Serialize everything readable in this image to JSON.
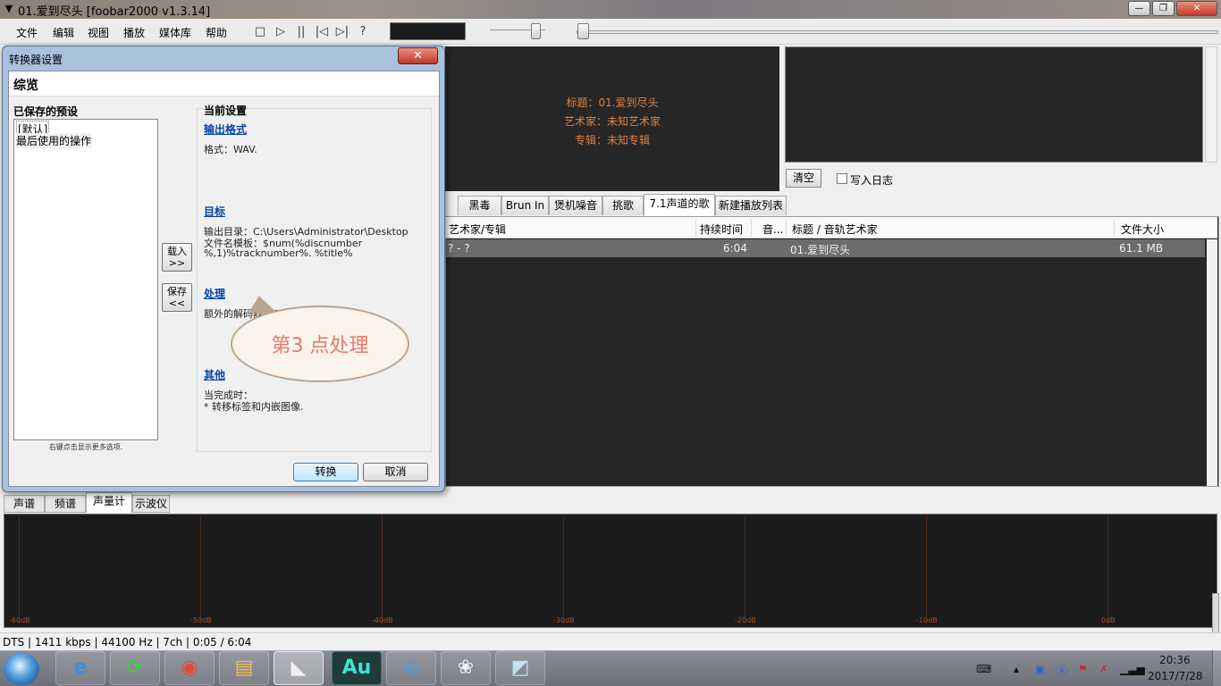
{
  "window": {
    "title": "01.爱到尽头  [foobar2000 v1.3.14]",
    "controls": [
      "—",
      "❐",
      "✕"
    ]
  },
  "menu": [
    "文件",
    "编辑",
    "视图",
    "播放",
    "媒体库",
    "帮助"
  ],
  "toolbar": [
    "□",
    "▷",
    "||",
    "|◁",
    "▷|",
    "?"
  ],
  "now_playing": {
    "title": "标题：01.爱到尽头",
    "artist": "艺术家：未知艺术家",
    "album": "专辑：未知专辑"
  },
  "console": {
    "clear_label": "清空",
    "log_label": "写入日志"
  },
  "playlist_tabs": [
    "黑毒",
    "Brun In",
    "煲机噪音",
    "挑歌",
    "7.1声道的歌",
    "新建播放列表"
  ],
  "playlist": {
    "columns": [
      "艺术家/专辑",
      "持续时间",
      "音...",
      "标题 / 音轨艺术家",
      "文件大小"
    ],
    "rows": [
      {
        "artist_album": "? - ?",
        "duration": "6:04",
        "track": "",
        "title": "01.爱到尽头",
        "size": "61.1 MB"
      }
    ]
  },
  "vis_tabs": [
    "声谱",
    "频谱",
    "声量计",
    "示波仪"
  ],
  "vis_scale": [
    "-60dB",
    "-50dB",
    "-40dB",
    "-30dB",
    "-20dB",
    "-10dB",
    "0dB"
  ],
  "status": "DTS | 1411 kbps | 44100 Hz | 7ch | 0:05 / 6:04",
  "taskbar": {
    "apps": [
      "e",
      "⟳",
      "◉",
      "▤",
      "◣",
      "Au",
      "◎",
      "❀",
      "◩"
    ],
    "time": "20:36",
    "date": "2017/7/28"
  },
  "dialog": {
    "title": "转换器设置",
    "close": "✕",
    "heading": "综览",
    "saved_presets_label": "已保存的预设",
    "presets": [
      "[默认]",
      "最后使用的操作"
    ],
    "hint": "右键点击显示更多选项.",
    "load_btn": "载入\n>>",
    "save_btn": "保存\n<<",
    "current_label": "当前设置",
    "output_format_link": "输出格式",
    "output_format_text": "格式：WAV.",
    "target_link": "目标",
    "target_text_1": "输出目录：C:\\Users\\Administrator\\Desktop",
    "target_text_2": "文件名模板：$num(%discnumber",
    "target_text_3": "%,1)%tracknumber%. %title%",
    "processing_link": "处理",
    "processing_text": "额外的解码器：Channel Mixer.",
    "other_link": "其他",
    "other_text_1": "当完成时：",
    "other_text_2": "* 转移标签和内嵌图像.",
    "convert_btn": "转换",
    "cancel_btn": "取消"
  },
  "annotation": "第3  点处理"
}
